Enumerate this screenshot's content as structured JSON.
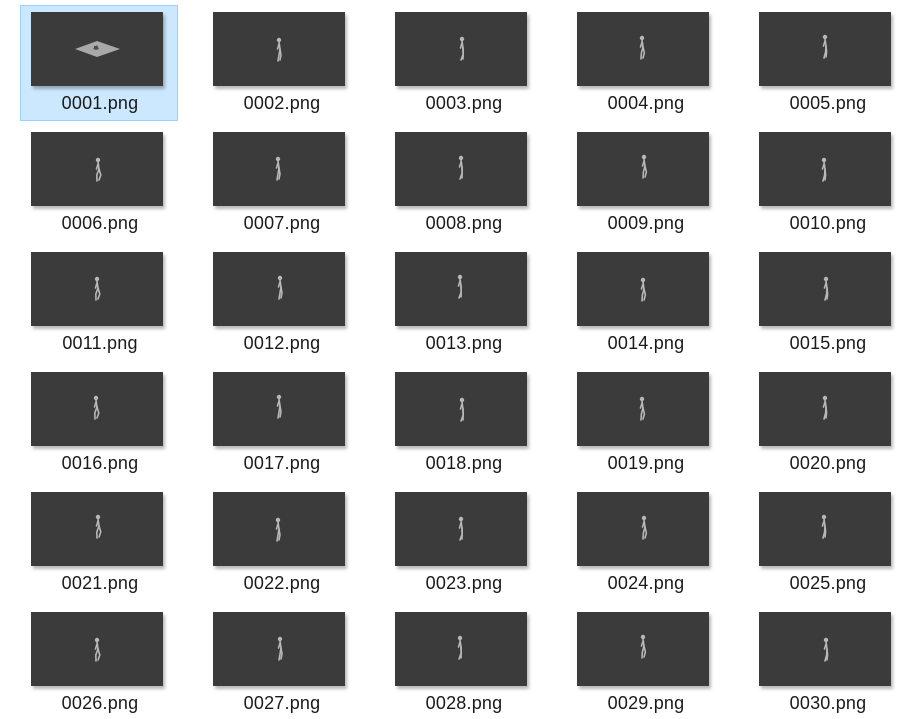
{
  "explorer": {
    "selected_index": 0,
    "files": [
      {
        "name": "0001.png",
        "thumbnail": "plane-icon"
      },
      {
        "name": "0002.png",
        "thumbnail": "figure-icon"
      },
      {
        "name": "0003.png",
        "thumbnail": "figure-icon"
      },
      {
        "name": "0004.png",
        "thumbnail": "figure-icon"
      },
      {
        "name": "0005.png",
        "thumbnail": "figure-icon"
      },
      {
        "name": "0006.png",
        "thumbnail": "figure-icon"
      },
      {
        "name": "0007.png",
        "thumbnail": "figure-icon"
      },
      {
        "name": "0008.png",
        "thumbnail": "figure-icon"
      },
      {
        "name": "0009.png",
        "thumbnail": "figure-icon"
      },
      {
        "name": "0010.png",
        "thumbnail": "figure-icon"
      },
      {
        "name": "0011.png",
        "thumbnail": "figure-icon"
      },
      {
        "name": "0012.png",
        "thumbnail": "figure-icon"
      },
      {
        "name": "0013.png",
        "thumbnail": "figure-icon"
      },
      {
        "name": "0014.png",
        "thumbnail": "figure-icon"
      },
      {
        "name": "0015.png",
        "thumbnail": "figure-icon"
      },
      {
        "name": "0016.png",
        "thumbnail": "figure-icon"
      },
      {
        "name": "0017.png",
        "thumbnail": "figure-icon"
      },
      {
        "name": "0018.png",
        "thumbnail": "figure-icon"
      },
      {
        "name": "0019.png",
        "thumbnail": "figure-icon"
      },
      {
        "name": "0020.png",
        "thumbnail": "figure-icon"
      },
      {
        "name": "0021.png",
        "thumbnail": "figure-icon"
      },
      {
        "name": "0022.png",
        "thumbnail": "figure-icon"
      },
      {
        "name": "0023.png",
        "thumbnail": "figure-icon"
      },
      {
        "name": "0024.png",
        "thumbnail": "figure-icon"
      },
      {
        "name": "0025.png",
        "thumbnail": "figure-icon"
      },
      {
        "name": "0026.png",
        "thumbnail": "figure-icon"
      },
      {
        "name": "0027.png",
        "thumbnail": "figure-icon"
      },
      {
        "name": "0028.png",
        "thumbnail": "figure-icon"
      },
      {
        "name": "0029.png",
        "thumbnail": "figure-icon"
      },
      {
        "name": "0030.png",
        "thumbnail": "figure-icon"
      }
    ]
  },
  "colors": {
    "thumbnail_bg": "#3b3b3b",
    "selection_bg": "#cce8ff",
    "selection_border": "#99d1ff",
    "figure": "#b8b8b8",
    "plane": "#a9a9a9"
  }
}
